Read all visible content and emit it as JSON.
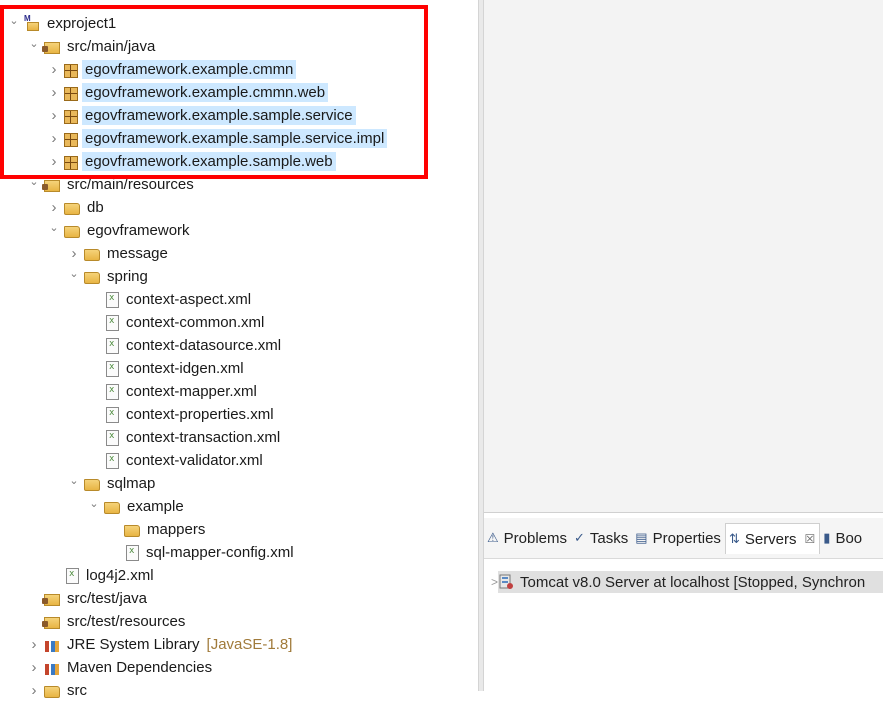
{
  "tree": {
    "rows": [
      {
        "label": "exproject1",
        "level": 0,
        "chev": "expanded",
        "icon": "project-icon",
        "hl": false
      },
      {
        "label": "src/main/java",
        "level": 1,
        "chev": "expanded",
        "icon": "source-folder-icon",
        "hl": false
      },
      {
        "label": "egovframework.example.cmmn",
        "level": 2,
        "chev": "collapsed",
        "icon": "package-icon",
        "hl": true
      },
      {
        "label": "egovframework.example.cmmn.web",
        "level": 2,
        "chev": "collapsed",
        "icon": "package-icon",
        "hl": true
      },
      {
        "label": "egovframework.example.sample.service",
        "level": 2,
        "chev": "collapsed",
        "icon": "package-icon",
        "hl": true
      },
      {
        "label": "egovframework.example.sample.service.impl",
        "level": 2,
        "chev": "collapsed",
        "icon": "package-icon",
        "hl": true
      },
      {
        "label": "egovframework.example.sample.web",
        "level": 2,
        "chev": "collapsed",
        "icon": "package-icon",
        "hl": true
      },
      {
        "label": "src/main/resources",
        "level": 1,
        "chev": "expanded",
        "icon": "source-folder-icon",
        "hl": false
      },
      {
        "label": "db",
        "level": 2,
        "chev": "collapsed",
        "icon": "folder-icon",
        "hl": false
      },
      {
        "label": "egovframework",
        "level": 2,
        "chev": "expanded",
        "icon": "folder-icon",
        "hl": false
      },
      {
        "label": "message",
        "level": 3,
        "chev": "collapsed",
        "icon": "folder-icon",
        "hl": false
      },
      {
        "label": "spring",
        "level": 3,
        "chev": "expanded",
        "icon": "folder-icon",
        "hl": false
      },
      {
        "label": "context-aspect.xml",
        "level": 4,
        "chev": "none",
        "icon": "xml-file-icon",
        "hl": false
      },
      {
        "label": "context-common.xml",
        "level": 4,
        "chev": "none",
        "icon": "xml-file-icon",
        "hl": false
      },
      {
        "label": "context-datasource.xml",
        "level": 4,
        "chev": "none",
        "icon": "xml-file-icon",
        "hl": false
      },
      {
        "label": "context-idgen.xml",
        "level": 4,
        "chev": "none",
        "icon": "xml-file-icon",
        "hl": false
      },
      {
        "label": "context-mapper.xml",
        "level": 4,
        "chev": "none",
        "icon": "xml-file-icon",
        "hl": false
      },
      {
        "label": "context-properties.xml",
        "level": 4,
        "chev": "none",
        "icon": "xml-file-icon",
        "hl": false
      },
      {
        "label": "context-transaction.xml",
        "level": 4,
        "chev": "none",
        "icon": "xml-file-icon",
        "hl": false
      },
      {
        "label": "context-validator.xml",
        "level": 4,
        "chev": "none",
        "icon": "xml-file-icon",
        "hl": false
      },
      {
        "label": "sqlmap",
        "level": 3,
        "chev": "expanded",
        "icon": "folder-icon",
        "hl": false
      },
      {
        "label": "example",
        "level": 4,
        "chev": "expanded",
        "icon": "folder-icon",
        "hl": false
      },
      {
        "label": "mappers",
        "level": 5,
        "chev": "none",
        "icon": "folder-icon",
        "hl": false
      },
      {
        "label": "sql-mapper-config.xml",
        "level": 5,
        "chev": "none",
        "icon": "xml-file-icon",
        "hl": false
      },
      {
        "label": "log4j2.xml",
        "level": 2,
        "chev": "none",
        "icon": "xml-file-icon",
        "hl": false
      },
      {
        "label": "src/test/java",
        "level": 1,
        "chev": "none",
        "icon": "source-folder-icon",
        "hl": false
      },
      {
        "label": "src/test/resources",
        "level": 1,
        "chev": "none",
        "icon": "source-folder-icon",
        "hl": false
      },
      {
        "label": "JRE System Library",
        "decor": "[JavaSE-1.8]",
        "level": 1,
        "chev": "collapsed",
        "icon": "library-icon",
        "hl": false
      },
      {
        "label": "Maven Dependencies",
        "level": 1,
        "chev": "collapsed",
        "icon": "library-icon",
        "hl": false
      },
      {
        "label": "src",
        "level": 1,
        "chev": "collapsed",
        "icon": "folder-icon",
        "hl": false
      }
    ]
  },
  "servers_view": {
    "tabs": [
      {
        "label": "Problems",
        "icon": "problems-icon",
        "active": false
      },
      {
        "label": "Tasks",
        "icon": "tasks-icon",
        "active": false
      },
      {
        "label": "Properties",
        "icon": "properties-icon",
        "active": false
      },
      {
        "label": "Servers",
        "icon": "servers-icon",
        "active": true,
        "close": "☒"
      },
      {
        "label": "Boo",
        "icon": "bookmarks-icon",
        "active": false
      }
    ],
    "server_entry": "Tomcat v8.0 Server at localhost  [Stopped, Synchron"
  },
  "colors": {
    "highlight": "#cde8ff",
    "callout": "#ff0000",
    "decoration": "#a07a3a"
  }
}
